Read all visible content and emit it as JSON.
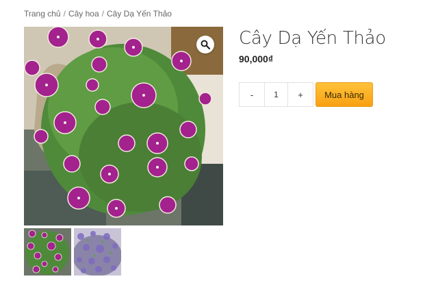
{
  "breadcrumb": {
    "items": [
      "Trang chủ",
      "Cây hoa",
      "Cây Dạ Yến Thảo"
    ],
    "separator": "/"
  },
  "product": {
    "title": "Cây Dạ Yến Thảo",
    "price": "90,000₫"
  },
  "cart": {
    "minus_label": "-",
    "quantity": "1",
    "plus_label": "+",
    "buy_label": "Mua hàng"
  },
  "icons": {
    "zoom": "magnifier-icon"
  },
  "colors": {
    "buy_button": "#f9a013",
    "flower": "#a3228d"
  }
}
